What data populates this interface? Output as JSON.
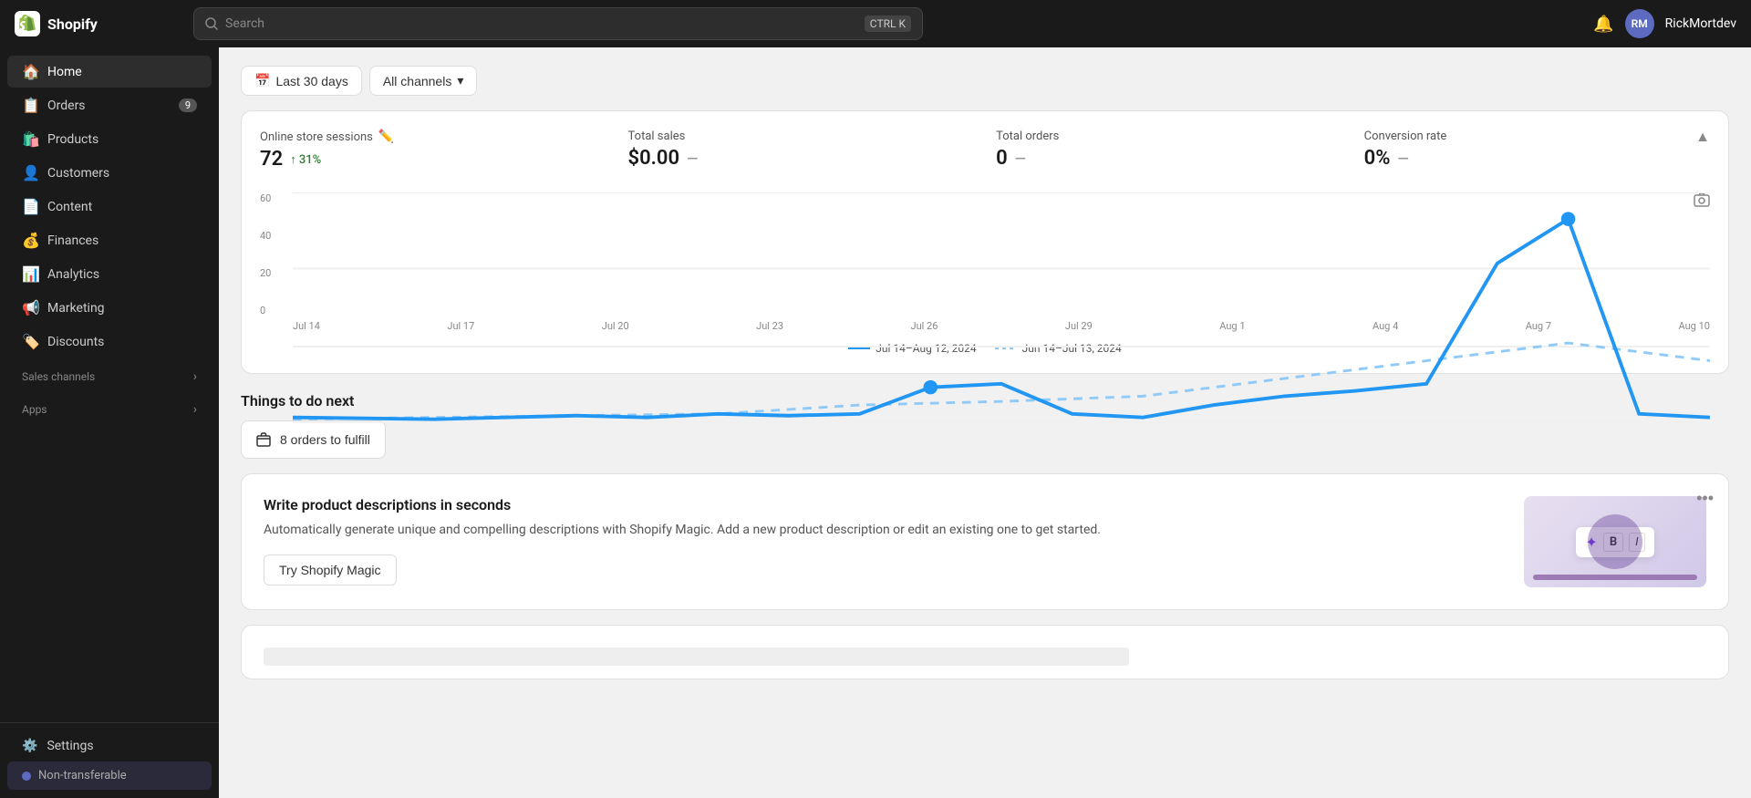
{
  "app": {
    "name": "Shopify"
  },
  "topnav": {
    "search_placeholder": "Search",
    "shortcut_key1": "CTRL",
    "shortcut_key2": "K",
    "username": "RickMortdev",
    "avatar_initials": "RM"
  },
  "sidebar": {
    "items": [
      {
        "id": "home",
        "label": "Home",
        "icon": "🏠",
        "active": true,
        "badge": ""
      },
      {
        "id": "orders",
        "label": "Orders",
        "icon": "📋",
        "active": false,
        "badge": "9"
      },
      {
        "id": "products",
        "label": "Products",
        "icon": "🛍️",
        "active": false,
        "badge": ""
      },
      {
        "id": "customers",
        "label": "Customers",
        "icon": "👤",
        "active": false,
        "badge": ""
      },
      {
        "id": "content",
        "label": "Content",
        "icon": "📄",
        "active": false,
        "badge": ""
      },
      {
        "id": "finances",
        "label": "Finances",
        "icon": "💰",
        "active": false,
        "badge": ""
      },
      {
        "id": "analytics",
        "label": "Analytics",
        "icon": "📊",
        "active": false,
        "badge": ""
      },
      {
        "id": "marketing",
        "label": "Marketing",
        "icon": "📢",
        "active": false,
        "badge": ""
      },
      {
        "id": "discounts",
        "label": "Discounts",
        "icon": "🏷️",
        "active": false,
        "badge": ""
      }
    ],
    "sections": [
      {
        "id": "sales-channels",
        "label": "Sales channels"
      },
      {
        "id": "apps",
        "label": "Apps"
      }
    ],
    "bottom_items": [
      {
        "id": "settings",
        "label": "Settings",
        "icon": "⚙️"
      }
    ],
    "non_transferable_label": "Non-transferable"
  },
  "filters": {
    "date_label": "Last 30 days",
    "channel_label": "All channels",
    "channel_arrow": "▾"
  },
  "stats": {
    "online_sessions_label": "Online store sessions",
    "online_sessions_value": "72",
    "online_sessions_change": "↑ 31%",
    "total_sales_label": "Total sales",
    "total_sales_value": "$0.00",
    "total_orders_label": "Total orders",
    "total_orders_value": "0",
    "conversion_rate_label": "Conversion rate",
    "conversion_rate_value": "0%"
  },
  "chart": {
    "y_labels": [
      "60",
      "40",
      "20",
      "0"
    ],
    "x_labels": [
      "Jul 14",
      "Jul 17",
      "Jul 20",
      "Jul 23",
      "Jul 26",
      "Jul 29",
      "Aug 1",
      "Aug 4",
      "Aug 7",
      "Aug 10"
    ],
    "legend_current": "Jul 14–Aug 12, 2024",
    "legend_previous": "Jun 14–Jul 13, 2024"
  },
  "todo": {
    "section_title": "Things to do next",
    "orders_label": "8 orders to fulfill"
  },
  "promo": {
    "title": "Write product descriptions in seconds",
    "description": "Automatically generate unique and compelling descriptions with Shopify Magic. Add a new product description or edit an existing one to get started.",
    "cta_label": "Try Shopify Magic",
    "image_text_magic": "✦",
    "image_text_b": "B",
    "image_text_i": "I",
    "more_icon": "•••"
  }
}
